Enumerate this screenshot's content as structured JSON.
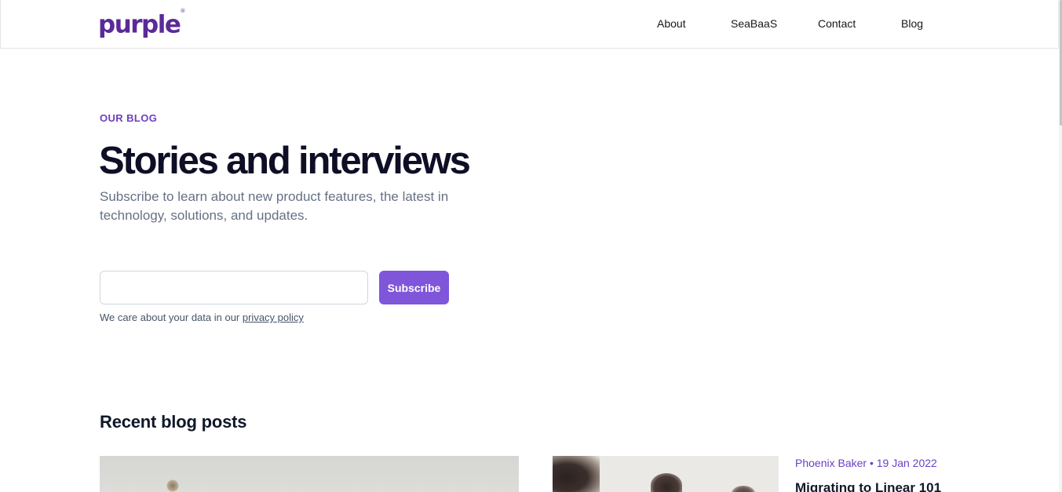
{
  "header": {
    "logo": "purple",
    "logo_mark": "®",
    "nav": [
      {
        "label": "About"
      },
      {
        "label": "SeaBaaS"
      },
      {
        "label": "Contact"
      },
      {
        "label": "Blog"
      }
    ]
  },
  "hero": {
    "eyebrow": "OUR BLOG",
    "title": "Stories and interviews",
    "subtitle": "Subscribe to learn about new product features, the latest in technology, solutions, and updates."
  },
  "subscribe_form": {
    "email_value": "",
    "email_placeholder": "",
    "button_label": "Subscribe",
    "privacy_prefix": "We care about your data in our ",
    "privacy_link": "privacy policy"
  },
  "recent": {
    "title": "Recent blog posts",
    "posts": [
      {
        "meta": "",
        "title": ""
      },
      {
        "meta": "Phoenix Baker • 19 Jan 2022",
        "title": "Migrating to Linear 101"
      }
    ]
  },
  "colors": {
    "brand": "#5b2a98",
    "accent": "#7f56d9",
    "eyebrow": "#6d3fc0",
    "text_dark": "#0e0e26",
    "text_muted": "#667085"
  }
}
